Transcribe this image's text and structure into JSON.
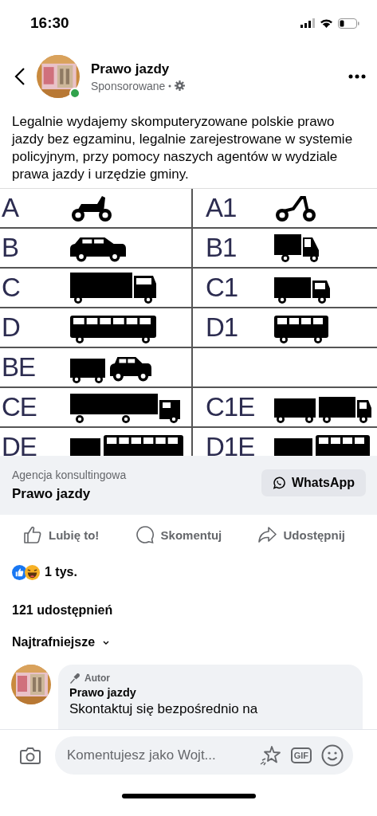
{
  "status_bar": {
    "time": "16:30"
  },
  "post": {
    "page_name": "Prawo jazdy",
    "sponsored": "Sponsorowane",
    "online": true,
    "text": "Legalnie wydajemy skomputeryzowane polskie prawo jazdy bez egzaminu, legalnie zarejestrowane w systemie policyjnym, przy pomocy naszych agentów w wydziale prawa jazdy i urzędzie gminy.",
    "license_table": {
      "rows": [
        {
          "cells": [
            {
              "label": "A",
              "kind": "motorcycle"
            },
            {
              "label": "A1",
              "kind": "moped"
            }
          ]
        },
        {
          "cells": [
            {
              "label": "B",
              "kind": "car"
            },
            {
              "label": "B1",
              "kind": "tricar"
            }
          ]
        },
        {
          "cells": [
            {
              "label": "C",
              "kind": "truck"
            },
            {
              "label": "C1",
              "kind": "small-truck"
            }
          ]
        },
        {
          "cells": [
            {
              "label": "D",
              "kind": "bus"
            },
            {
              "label": "D1",
              "kind": "minibus"
            }
          ]
        },
        {
          "cells": [
            {
              "label": "BE",
              "kind": "car-trailer"
            },
            null
          ]
        },
        {
          "cells": [
            {
              "label": "CE",
              "kind": "semi-truck"
            },
            {
              "label": "C1E",
              "kind": "truck-trailer"
            }
          ]
        },
        {
          "cells": [
            {
              "label": "DE",
              "kind": "bus-trailer"
            },
            {
              "label": "D1E",
              "kind": "minibus-trailer"
            }
          ]
        }
      ]
    }
  },
  "ad_footer": {
    "category": "Agencja konsultingowa",
    "name": "Prawo jazdy",
    "button": "WhatsApp"
  },
  "actions": [
    {
      "kind": "like",
      "label": "Lubię to!"
    },
    {
      "kind": "comment",
      "label": "Skomentuj"
    },
    {
      "kind": "share",
      "label": "Udostępnij"
    }
  ],
  "reactions": {
    "count": "1 tys."
  },
  "shares": "121 udostępnień",
  "sort": "Najtrafniejsze",
  "comment": {
    "badge": "Autor",
    "author": "Prawo jazdy",
    "text": "Skontaktuj się bezpośrednio na"
  },
  "composer": {
    "placeholder": "Komentujesz jako Wojt...",
    "gif": "GIF"
  }
}
